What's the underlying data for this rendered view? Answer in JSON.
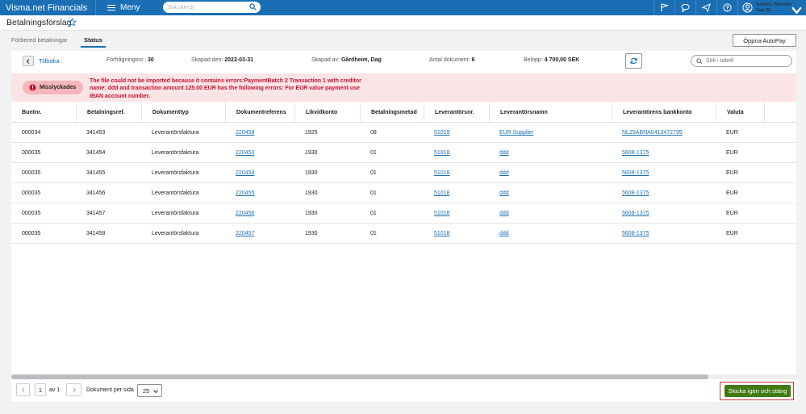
{
  "app": {
    "brand": "Visma.net Financials",
    "menu_label": "Meny",
    "search_placeholder": "Sök (Alt+S)",
    "user_name": "Anders Nilsson",
    "user_company": "Dag SE"
  },
  "page": {
    "title": "Betalningsförslag",
    "tabs": [
      "Förbered betalningar",
      "Status"
    ],
    "active_tab": "Status",
    "autopay_label": "Öppna AutoPay"
  },
  "info": {
    "back_label": "Tillbaka",
    "request_no_label": "Förfrågningsnr.:",
    "request_no": "30",
    "created_label": "Skapad den:",
    "created": "2022-03-31",
    "created_by_label": "Skapad av:",
    "created_by": "Gårdheim, Dag",
    "doc_count_label": "Antal dokument:",
    "doc_count": "6",
    "amount_label": "Belopp:",
    "amount": "4 700,00 SEK",
    "table_search_placeholder": "Sök i tabell"
  },
  "error": {
    "badge": "Misslyckades",
    "message": "The file could not be imported because it contains errors:PaymentBatch 2 Transaction 1 with creditor name: ddd and transaction amount 125.00 EUR has the following errors: For EUR value payment use IBAN account number."
  },
  "table": {
    "columns": [
      "Buntnr.",
      "Betalningsref.",
      "Dokumenttyp",
      "Dokumentreferens",
      "Likvidkonto",
      "Betalningsmetod",
      "Leverantörsnr.",
      "Leverantörsnamn",
      "Leverantörens bankkonto",
      "Valuta"
    ],
    "rows": [
      [
        "000034",
        "341453",
        "Leverantörsfaktura",
        "220458",
        "1925",
        "08",
        "51019",
        "EUR Supplier",
        "NL25ABNA0413472795",
        "EUR"
      ],
      [
        "000035",
        "341454",
        "Leverantörsfaktura",
        "220453",
        "1930",
        "01",
        "51018",
        "ddd",
        "5608-1375",
        "EUR"
      ],
      [
        "000035",
        "341455",
        "Leverantörsfaktura",
        "220454",
        "1930",
        "01",
        "51018",
        "ddd",
        "5608-1375",
        "EUR"
      ],
      [
        "000035",
        "341456",
        "Leverantörsfaktura",
        "220455",
        "1930",
        "01",
        "51018",
        "ddd",
        "5608-1375",
        "EUR"
      ],
      [
        "000035",
        "341457",
        "Leverantörsfaktura",
        "220456",
        "1930",
        "01",
        "51018",
        "ddd",
        "5608-1375",
        "EUR"
      ],
      [
        "000035",
        "341458",
        "Leverantörsfaktura",
        "220457",
        "1930",
        "01",
        "51018",
        "ddd",
        "5608-1375",
        "EUR"
      ]
    ]
  },
  "footer": {
    "page": "1",
    "of_label": "av 1",
    "per_page_label": "Dokument per sida",
    "per_page": "25",
    "send_label": "Skicka igen och stäng"
  },
  "colors": {
    "topbar": "#1a6fb4",
    "error_bg": "#fbe4e6",
    "error_text": "#c8102e",
    "primary_button": "#3f7a13"
  }
}
